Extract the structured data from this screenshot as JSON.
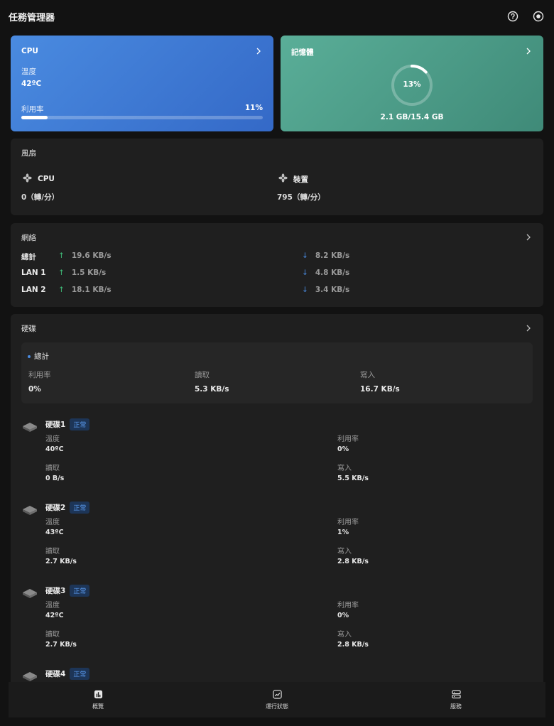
{
  "app": {
    "title": "任務管理器",
    "help_icon": "help-icon",
    "settings_icon": "target-icon"
  },
  "cpu": {
    "title": "CPU",
    "temp_label": "溫度",
    "temp_value": "42ºC",
    "usage_label": "利用率",
    "usage_value": "11%",
    "usage_fraction": 0.11
  },
  "memory": {
    "title": "記憶體",
    "percent_text": "13%",
    "percent": 0.13,
    "usage_text": "2.1 GB/15.4 GB"
  },
  "fan": {
    "title": "風扇",
    "items": [
      {
        "label": "CPU",
        "value": "0（轉/分）"
      },
      {
        "label": "裝置",
        "value": "795（轉/分）"
      }
    ]
  },
  "network": {
    "title": "網絡",
    "rows": [
      {
        "name": "總計",
        "up": "19.6 KB/s",
        "down": "8.2 KB/s"
      },
      {
        "name": "LAN 1",
        "up": "1.5 KB/s",
        "down": "4.8 KB/s"
      },
      {
        "name": "LAN 2",
        "up": "18.1 KB/s",
        "down": "3.4 KB/s"
      }
    ]
  },
  "disk": {
    "title": "硬碟",
    "summary": {
      "title": "總計",
      "usage_label": "利用率",
      "usage_value": "0%",
      "read_label": "讀取",
      "read_value": "5.3 KB/s",
      "write_label": "寫入",
      "write_value": "16.7 KB/s"
    },
    "items": [
      {
        "name": "硬碟1",
        "status": "正常",
        "temp_label": "溫度",
        "temp": "40ºC",
        "usage_label": "利用率",
        "usage": "0%",
        "read_label": "讀取",
        "read": "0 B/s",
        "write_label": "寫入",
        "write": "5.5 KB/s"
      },
      {
        "name": "硬碟2",
        "status": "正常",
        "temp_label": "溫度",
        "temp": "43ºC",
        "usage_label": "利用率",
        "usage": "1%",
        "read_label": "讀取",
        "read": "2.7 KB/s",
        "write_label": "寫入",
        "write": "2.8 KB/s"
      },
      {
        "name": "硬碟3",
        "status": "正常",
        "temp_label": "溫度",
        "temp": "42ºC",
        "usage_label": "利用率",
        "usage": "0%",
        "read_label": "讀取",
        "read": "2.7 KB/s",
        "write_label": "寫入",
        "write": "2.8 KB/s"
      },
      {
        "name": "硬碟4",
        "status": "正常"
      }
    ]
  },
  "nav": {
    "items": [
      {
        "label": "概覽",
        "icon": "bar-chart-icon"
      },
      {
        "label": "運行狀態",
        "icon": "line-chart-icon"
      },
      {
        "label": "服務",
        "icon": "server-icon"
      }
    ]
  },
  "colors": {
    "cpu_accent": "#3d78d6",
    "memory_accent": "#4e9e89",
    "up_arrow": "#3fbf7a",
    "down_arrow": "#4a8be0"
  }
}
